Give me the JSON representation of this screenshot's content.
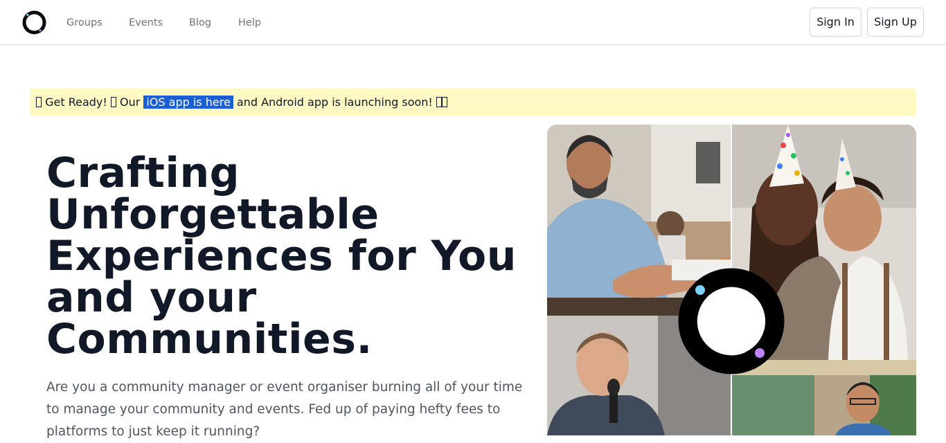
{
  "nav": {
    "logo": "logo-icon",
    "links": [
      "Groups",
      "Events",
      "Blog",
      "Help"
    ],
    "sign_in": "Sign In",
    "sign_up": "Sign Up"
  },
  "announcement": {
    "part1": "Get Ready!",
    "part2": "Our",
    "link": "iOS app is here",
    "part3": "and Android app is launching soon!"
  },
  "hero": {
    "headline": "Crafting Unforgettable Experiences for You and your Communities.",
    "description": "Are you a community manager or event organiser burning all of your time to manage your community and events. Fed up of paying hefty fees to platforms to just keep it running?"
  },
  "colors": {
    "announcement_bg": "#fef9c3",
    "highlight": "#1a5fd6",
    "headline": "#111827",
    "nav_text": "#6b7280"
  }
}
